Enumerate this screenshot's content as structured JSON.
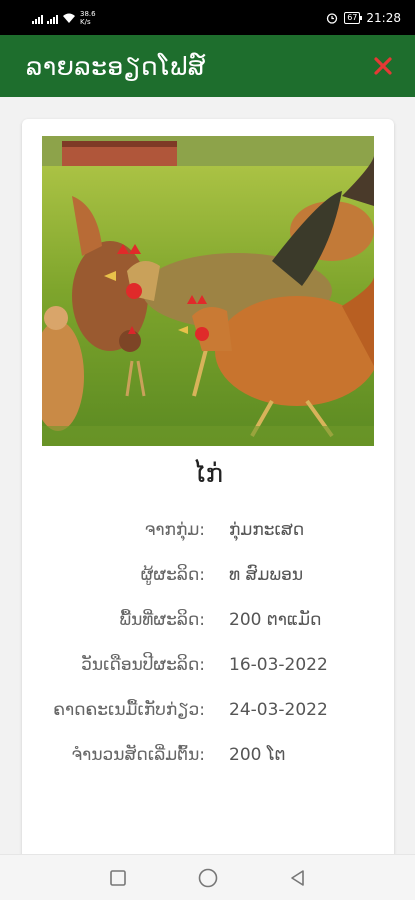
{
  "status_bar": {
    "net_speed": "38.6",
    "net_unit": "K/s",
    "battery": "67",
    "time": "21:28"
  },
  "app_bar": {
    "title": "ລາຍລະອຽດໂຟສ໌",
    "close_icon": "close-icon",
    "close_color": "#e53935",
    "bar_color": "#1e6e2d"
  },
  "product": {
    "name": "ໄກ່",
    "details": [
      {
        "label": "ຈາກກຸ່ມ:",
        "value": "ກຸ່ມກະເສດ"
      },
      {
        "label": "ຜູ້ຜະລິດ:",
        "value": "ທ ສົມພອນ"
      },
      {
        "label": "ພື້ນທີ່ຜະລິດ:",
        "value": "200 ຕາແມັດ"
      },
      {
        "label": "ວັນເດືອນປີຜະລິດ:",
        "value": "16-03-2022"
      },
      {
        "label": "ຄາດຄະເນມື້ເກັບກ່ຽວ:",
        "value": "24-03-2022"
      },
      {
        "label": "ຈຳນວນສັດເລີ່ມຕົ້ນ:",
        "value": "200 ໂຕ"
      }
    ]
  },
  "nav": {
    "recents": "square-icon",
    "home": "circle-icon",
    "back": "triangle-back-icon"
  }
}
